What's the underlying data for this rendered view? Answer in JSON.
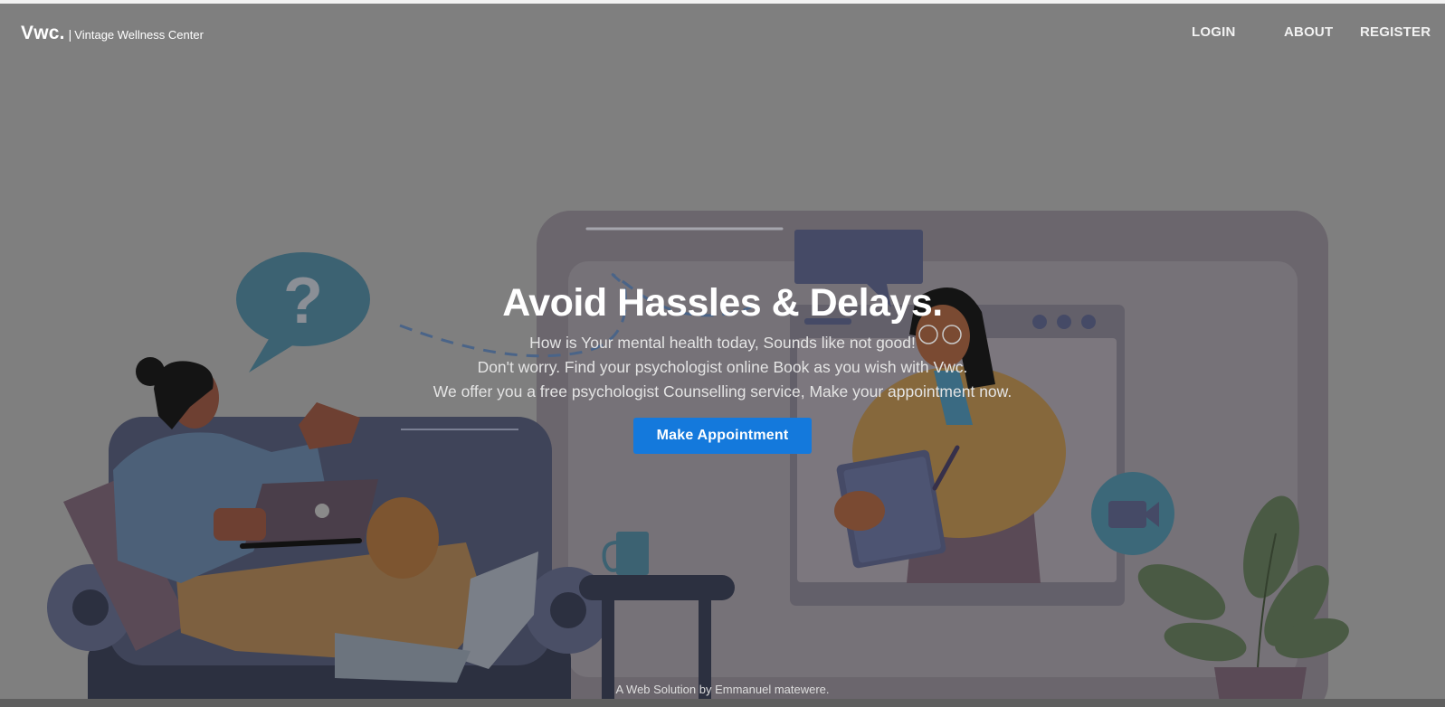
{
  "nav": {
    "logo": "Vwc.",
    "separator": "|",
    "brand_name": "Vintage Wellness Center",
    "links": [
      {
        "label": "LOGIN"
      },
      {
        "label": "ABOUT"
      },
      {
        "label": "REGISTER"
      }
    ]
  },
  "hero": {
    "title": "Avoid Hassles & Delays.",
    "lines": [
      "How is Your mental health today, Sounds like not good!",
      "Don't worry. Find your psychologist online Book as you wish with Vwc.",
      "We offer you a free psychologist Counselling service, Make your appointment now."
    ],
    "cta_label": "Make Appointment"
  },
  "illustration": {
    "question_mark": "?",
    "icons": [
      "question-bubble-icon",
      "video-camera-icon",
      "plant-icon",
      "laptop-icon",
      "mug-icon"
    ]
  },
  "footer": {
    "credit": "A Web Solution by Emmanuel matewere."
  },
  "colors": {
    "overlay": "#7f7f7f",
    "cta": "#1479dc",
    "text": "#ffffff"
  }
}
